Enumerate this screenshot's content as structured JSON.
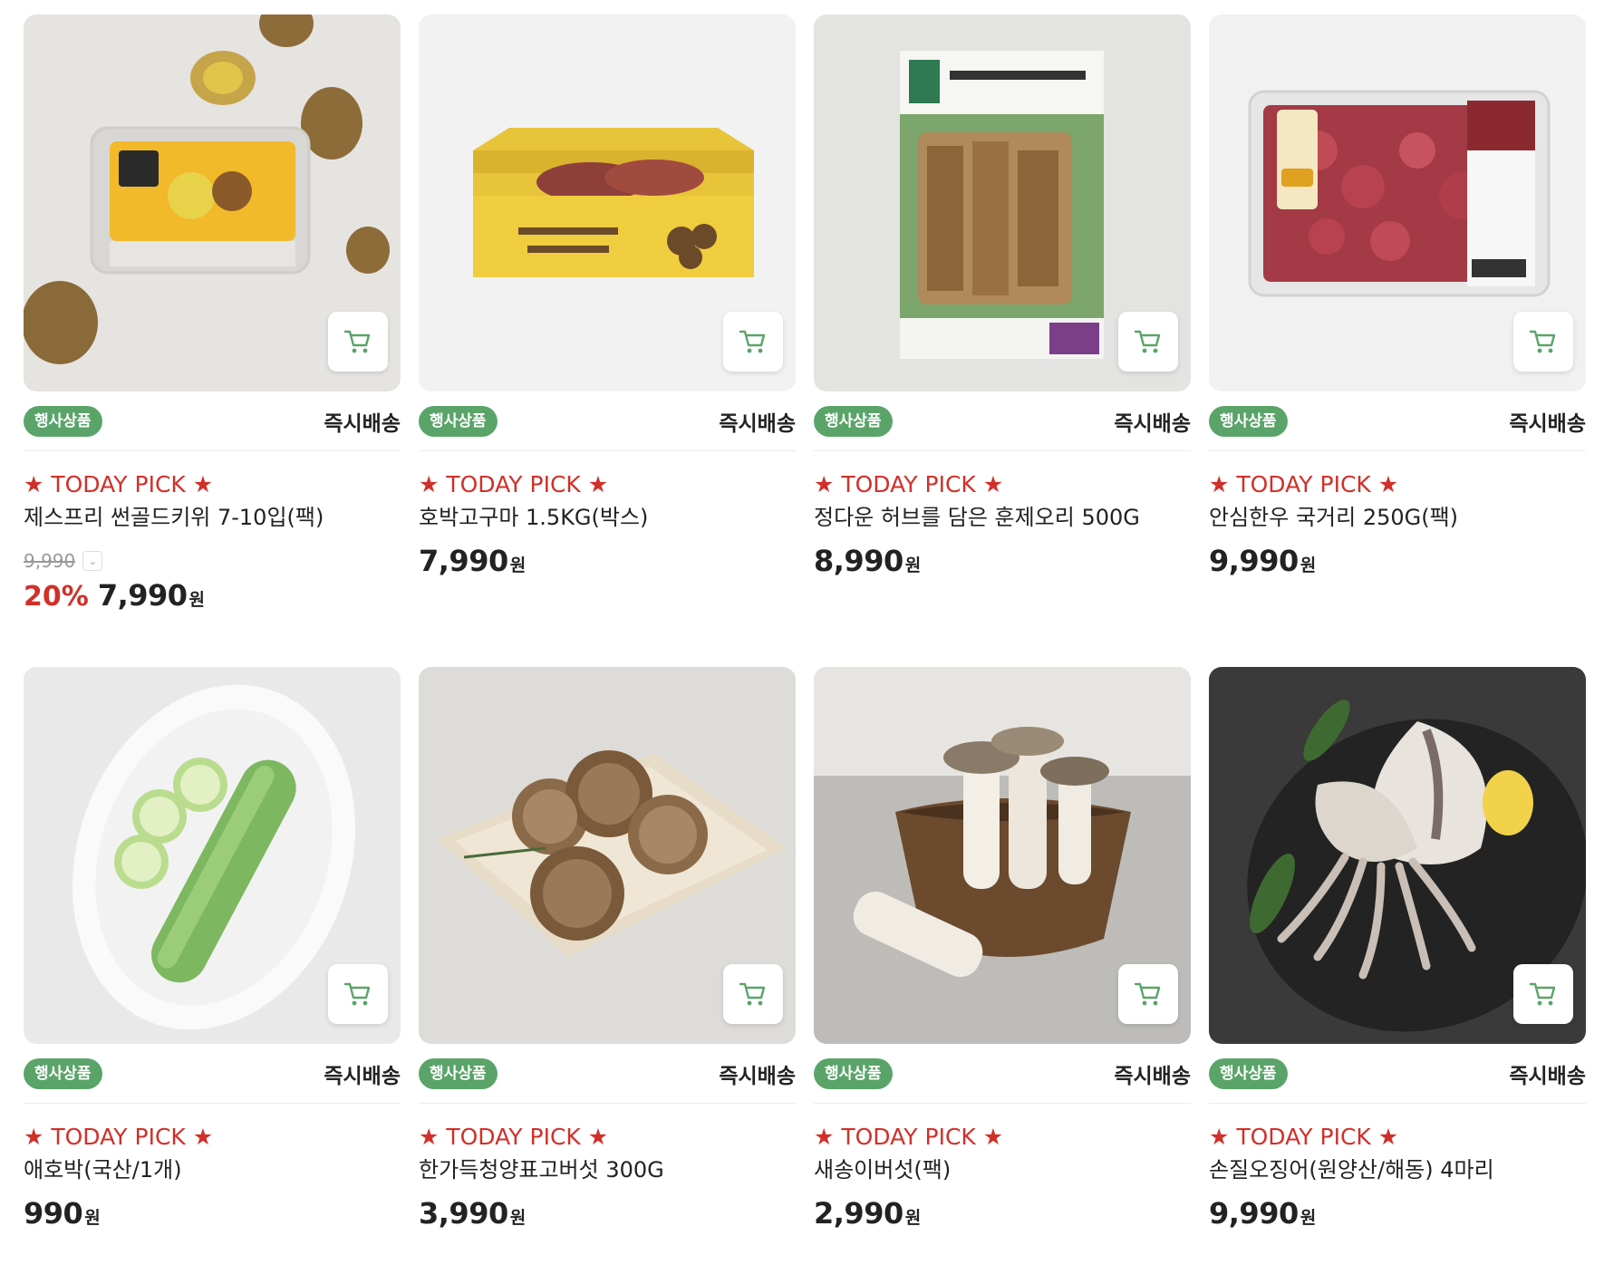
{
  "products": [
    {
      "event_badge": "행사상품",
      "delivery": "즉시배송",
      "pick": "★ TODAY PICK ★",
      "name": "제스프리 썬골드키위 7-10입(팩)",
      "original_price": "9,990",
      "discount": "20%",
      "price": "7,990",
      "currency": "원",
      "image": "kiwi-pack"
    },
    {
      "event_badge": "행사상품",
      "delivery": "즉시배송",
      "pick": "★ TODAY PICK ★",
      "name": "호박고구마 1.5KG(박스)",
      "price": "7,990",
      "currency": "원",
      "image": "sweet-potato-box"
    },
    {
      "event_badge": "행사상품",
      "delivery": "즉시배송",
      "pick": "★ TODAY PICK ★",
      "name": "정다운 허브를 담은 훈제오리 500G",
      "price": "8,990",
      "currency": "원",
      "image": "smoked-duck-pack"
    },
    {
      "event_badge": "행사상품",
      "delivery": "즉시배송",
      "pick": "★ TODAY PICK ★",
      "name": "안심한우 국거리 250G(팩)",
      "price": "9,990",
      "currency": "원",
      "image": "beef-tray"
    },
    {
      "event_badge": "행사상품",
      "delivery": "즉시배송",
      "pick": "★ TODAY PICK ★",
      "name": "애호박(국산/1개)",
      "price": "990",
      "currency": "원",
      "image": "zucchini"
    },
    {
      "event_badge": "행사상품",
      "delivery": "즉시배송",
      "pick": "★ TODAY PICK ★",
      "name": "한가득청양표고버섯 300G",
      "price": "3,990",
      "currency": "원",
      "image": "shiitake"
    },
    {
      "event_badge": "행사상품",
      "delivery": "즉시배송",
      "pick": "★ TODAY PICK ★",
      "name": "새송이버섯(팩)",
      "price": "2,990",
      "currency": "원",
      "image": "king-oyster"
    },
    {
      "event_badge": "행사상품",
      "delivery": "즉시배송",
      "pick": "★ TODAY PICK ★",
      "name": "손질오징어(원양산/해동) 4마리",
      "price": "9,990",
      "currency": "원",
      "image": "squid"
    }
  ],
  "colors": {
    "badge_green": "#5aa469",
    "pick_red": "#d1302a",
    "discount_red": "#d1302a",
    "cart_icon_green": "#5aa469"
  },
  "icons": {
    "cart": "cart-icon",
    "chevron": "chevron-down-icon"
  }
}
